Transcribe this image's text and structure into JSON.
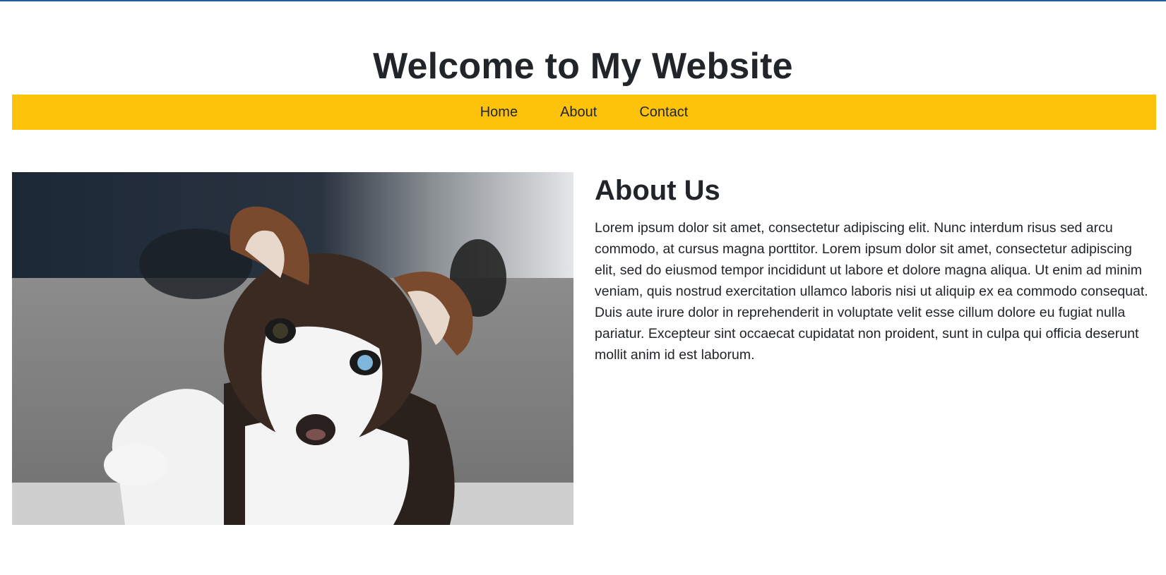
{
  "header": {
    "title": "Welcome to My Website"
  },
  "nav": {
    "items": [
      "Home",
      "About",
      "Contact"
    ]
  },
  "about": {
    "heading": "About Us",
    "body": "Lorem ipsum dolor sit amet, consectetur adipiscing elit. Nunc interdum risus sed arcu commodo, at cursus magna porttitor. Lorem ipsum dolor sit amet, consectetur adipiscing elit, sed do eiusmod tempor incididunt ut labore et dolore magna aliqua. Ut enim ad minim veniam, quis nostrud exercitation ullamco laboris nisi ut aliquip ex ea commodo consequat. Duis aute irure dolor in reprehenderit in voluptate velit esse cillum dolore eu fugiat nulla pariatur. Excepteur sint occaecat cupidatat non proident, sunt in culpa qui officia deserunt mollit anim id est laborum."
  },
  "photo": {
    "subject": "husky-puppy-photo"
  },
  "colors": {
    "navbar": "#fcc30a",
    "text": "#212529",
    "top_rule": "#1f5f9e"
  }
}
